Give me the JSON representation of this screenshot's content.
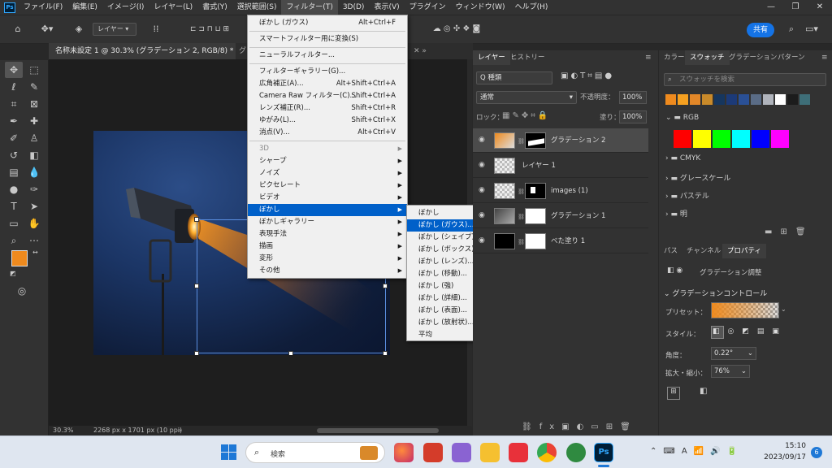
{
  "menubar": {
    "items": [
      "ファイル(F)",
      "編集(E)",
      "イメージ(I)",
      "レイヤー(L)",
      "書式(Y)",
      "選択範囲(S)",
      "フィルター(T)",
      "3D(D)",
      "表示(V)",
      "プラグイン",
      "ウィンドウ(W)",
      "ヘルプ(H)"
    ],
    "active": "フィルター(T)"
  },
  "options": {
    "layer_select": "レイヤー",
    "share": "共有"
  },
  "document": {
    "tab_title": "名称未設定 1 @ 30.3% (グラデーション 2, RGB/8) *",
    "tab2": "グ",
    "zoom": "30.3%",
    "info": "2268 px x 1701 px (10 ppi)"
  },
  "filter_menu": [
    {
      "label": "ぼかし (ガウス)",
      "shortcut": "Alt+Ctrl+F"
    },
    {
      "sep": true
    },
    {
      "label": "スマートフィルター用に変換(S)"
    },
    {
      "sep": true
    },
    {
      "label": "ニューラルフィルター..."
    },
    {
      "sep": true
    },
    {
      "label": "フィルターギャラリー(G)..."
    },
    {
      "label": "広角補正(A)...",
      "shortcut": "Alt+Shift+Ctrl+A"
    },
    {
      "label": "Camera Raw フィルター(C)...",
      "shortcut": "Shift+Ctrl+A"
    },
    {
      "label": "レンズ補正(R)...",
      "shortcut": "Shift+Ctrl+R"
    },
    {
      "label": "ゆがみ(L)...",
      "shortcut": "Shift+Ctrl+X"
    },
    {
      "label": "消点(V)...",
      "shortcut": "Alt+Ctrl+V"
    },
    {
      "sep": true
    },
    {
      "label": "3D",
      "submenu": true,
      "disabled": true
    },
    {
      "label": "シャープ",
      "submenu": true
    },
    {
      "label": "ノイズ",
      "submenu": true
    },
    {
      "label": "ピクセレート",
      "submenu": true
    },
    {
      "label": "ビデオ",
      "submenu": true
    },
    {
      "label": "ぼかし",
      "submenu": true,
      "highlight": true
    },
    {
      "label": "ぼかしギャラリー",
      "submenu": true
    },
    {
      "label": "表現手法",
      "submenu": true
    },
    {
      "label": "描画",
      "submenu": true
    },
    {
      "label": "変形",
      "submenu": true
    },
    {
      "label": "その他",
      "submenu": true
    }
  ],
  "blur_submenu": [
    {
      "label": "ぼかし"
    },
    {
      "label": "ぼかし (ガウス)...",
      "highlight": true
    },
    {
      "label": "ぼかし (シェイプ)..."
    },
    {
      "label": "ぼかし (ボックス)..."
    },
    {
      "label": "ぼかし (レンズ)..."
    },
    {
      "label": "ぼかし (移動)..."
    },
    {
      "label": "ぼかし (強)"
    },
    {
      "label": "ぼかし (詳細)..."
    },
    {
      "label": "ぼかし (表面)..."
    },
    {
      "label": "ぼかし (放射状)..."
    },
    {
      "label": "平均"
    }
  ],
  "layers_panel": {
    "tabs": [
      "レイヤー",
      "ヒストリー"
    ],
    "kind": "Q 種類",
    "blend": "通常",
    "opacity_label": "不透明度：",
    "opacity": "100%",
    "lock_label": "ロック：",
    "fill_label": "塗り：",
    "fill": "100%",
    "layers": [
      {
        "name": "グラデーション 2",
        "selected": true
      },
      {
        "name": "レイヤー 1"
      },
      {
        "name": "images (1)"
      },
      {
        "name": "グラデーション 1"
      },
      {
        "name": "べた塗り 1"
      }
    ]
  },
  "swatches_panel": {
    "tabs": [
      "カラー",
      "スウォッチ",
      "グラデーション",
      "パターン"
    ],
    "search_placeholder": "スウォッチを検索",
    "recent_colors": [
      "#ee8a1e",
      "#f5a020",
      "#e28728",
      "#c98a2a",
      "#16365e",
      "#1c3a78",
      "#2a5096",
      "#5a6c86",
      "#b0b4bc",
      "#ffffff",
      "#1c1c1c",
      "#3e6e78"
    ],
    "groups": [
      "RGB",
      "CMYK",
      "グレースケール",
      "パステル",
      "明"
    ],
    "rgb_colors": [
      "#ff0000",
      "#ffff00",
      "#00ff00",
      "#00ffff",
      "#0000ff",
      "#ff00ff"
    ]
  },
  "properties_panel": {
    "tabs": [
      "パス",
      "チャンネル",
      "プロパティ"
    ],
    "type": "グラデーション調整",
    "section": "グラデーションコントロール",
    "preset_label": "プリセット：",
    "style_label": "スタイル：",
    "angle_label": "角度：",
    "angle": "0.22°",
    "scale_label": "拡大・縮小：",
    "scale": "76%"
  },
  "taskbar": {
    "search": "検索",
    "time": "15:10",
    "date": "2023/09/17",
    "notif": "6"
  }
}
